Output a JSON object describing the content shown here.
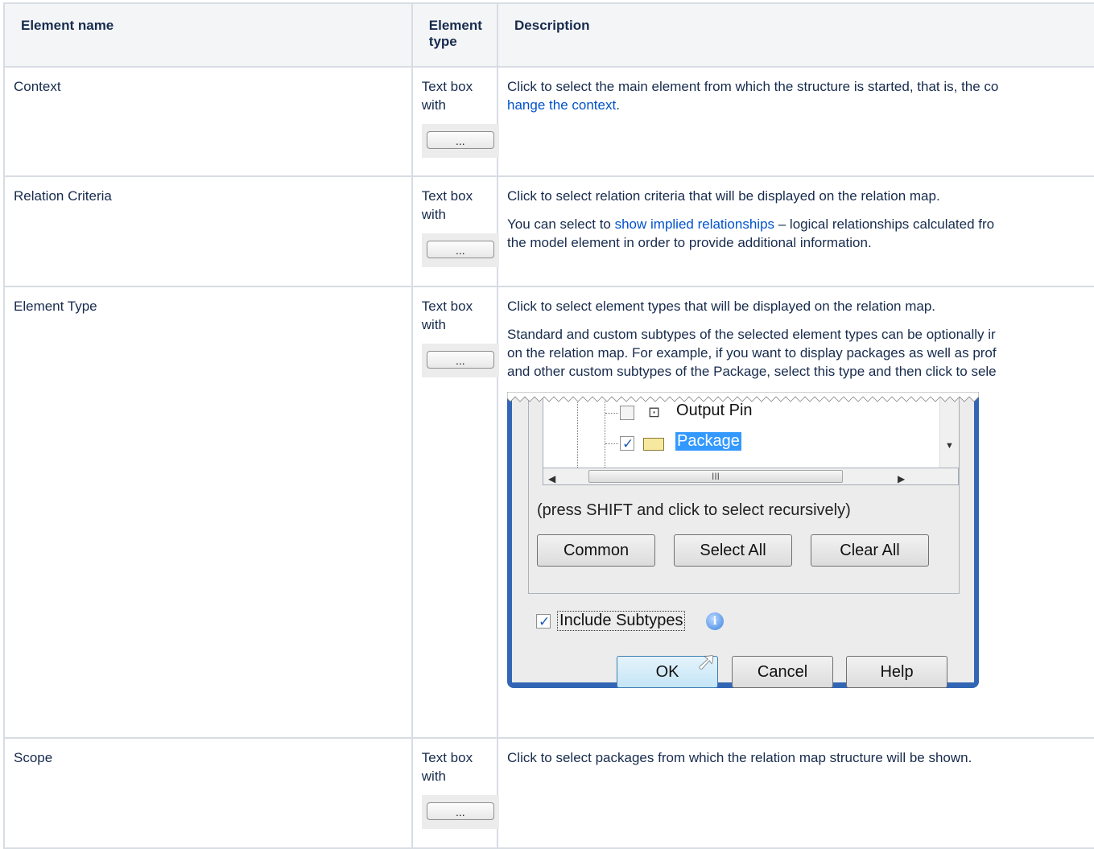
{
  "headers": {
    "name": "Element name",
    "type": "Element type",
    "description": "Description"
  },
  "button_dots": "...",
  "rows": [
    {
      "name": "Context",
      "type": "Text box with",
      "desc_p1_pre": "Click to select the main element from which the structure is started, that is, the co",
      "desc_link": "hange the context",
      "desc_p1_post": "."
    },
    {
      "name": "Relation Criteria",
      "type": "Text box with",
      "desc_p1": "Click to select relation criteria that will be displayed on the relation map.",
      "desc_p2_pre": "You can select to ",
      "desc_link": "show implied relationships",
      "desc_p2_post": " – logical relationships calculated fro",
      "desc_p2_line2": "the model element in order to provide additional information."
    },
    {
      "name": "Element Type",
      "type": "Text box with",
      "desc_p1": "Click to select element types that will be displayed on the relation map.",
      "desc_p2_l1": "Standard and custom subtypes of the selected element types can be optionally ir",
      "desc_p2_l2": "on the relation map. For example, if you want to display packages as well as prof",
      "desc_p2_l3": "and other custom subtypes of the Package, select this type and then click to sele"
    },
    {
      "name": "Scope",
      "type": "Text box with",
      "desc_p1": "Click to select packages from which the relation map structure will be shown."
    }
  ],
  "dialog": {
    "tree_items": [
      {
        "label": "Output Pin",
        "checked": false
      },
      {
        "label": "Package",
        "checked": true,
        "selected": true
      }
    ],
    "scroll_grip": "III",
    "hint": "(press SHIFT and click to select recursively)",
    "buttons": {
      "common": "Common",
      "select_all": "Select All",
      "clear_all": "Clear All"
    },
    "include_subtypes": "Include Subtypes",
    "include_checked": true,
    "info_glyph": "i",
    "ok": "OK",
    "cancel": "Cancel",
    "help": "Help"
  },
  "colors": {
    "link": "#0052cc",
    "header_bg": "#f4f5f7",
    "border": "#d8dce3",
    "dialog_frame": "#3266b5"
  }
}
